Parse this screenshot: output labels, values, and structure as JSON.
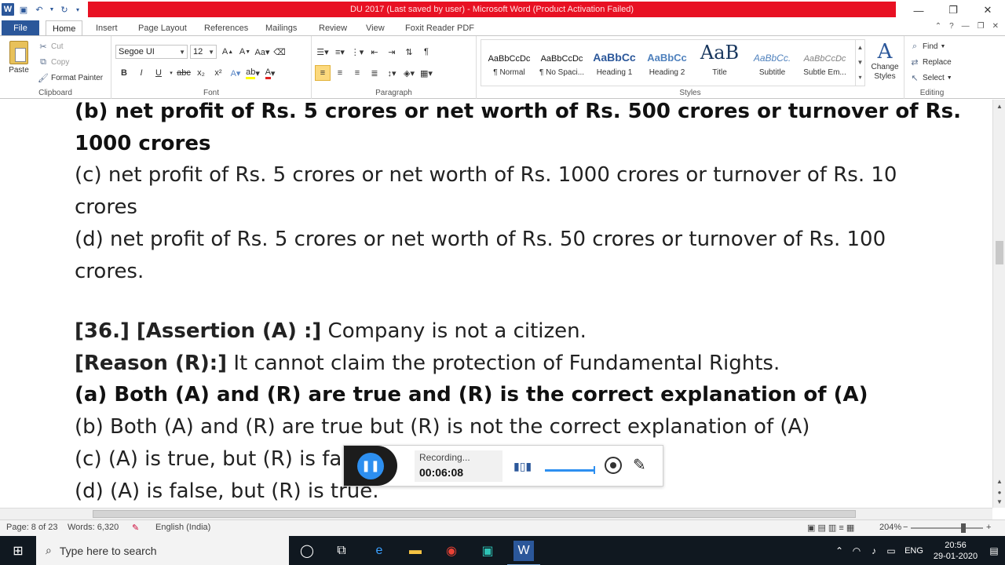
{
  "titlebar": {
    "title": "DU 2017 (Last saved by user)  -  Microsoft Word (Product Activation Failed)",
    "minimize": "—",
    "restore": "❐",
    "close": "✕"
  },
  "tabs": {
    "file": "File",
    "home": "Home",
    "insert": "Insert",
    "page_layout": "Page Layout",
    "references": "References",
    "mailings": "Mailings",
    "review": "Review",
    "view": "View",
    "foxit": "Foxit Reader PDF"
  },
  "ribbon": {
    "clipboard": {
      "paste": "Paste",
      "cut": "Cut",
      "copy": "Copy",
      "format_painter": "Format Painter",
      "label": "Clipboard"
    },
    "font": {
      "name": "Segoe UI",
      "size": "12",
      "label": "Font"
    },
    "paragraph": {
      "label": "Paragraph"
    },
    "styles": {
      "items": [
        {
          "preview": "AaBbCcDc",
          "name": "¶ Normal"
        },
        {
          "preview": "AaBbCcDc",
          "name": "¶ No Spaci..."
        },
        {
          "preview": "AaBbCc",
          "name": "Heading 1"
        },
        {
          "preview": "AaBbCc",
          "name": "Heading 2"
        },
        {
          "preview": "AaB",
          "name": "Title"
        },
        {
          "preview": "AaBbCc.",
          "name": "Subtitle"
        },
        {
          "preview": "AaBbCcDc",
          "name": "Subtle Em..."
        }
      ],
      "change_styles": "Change Styles",
      "label": "Styles"
    },
    "editing": {
      "find": "Find",
      "replace": "Replace",
      "select": "Select",
      "label": "Editing"
    }
  },
  "document": {
    "line_b1": "(b) net profit of Rs. 5 crores or net worth of Rs. 500 crores or turnover of Rs.",
    "line_b2": "1000 crores",
    "line_c1": "(c) net profit of Rs. 5 crores or net worth of Rs. 1000 crores or turnover of Rs. 10",
    "line_c2": "crores",
    "line_d1": "(d) net profit of Rs. 5 crores or net worth of Rs. 50 crores or turnover of Rs. 100",
    "line_d2": "crores.",
    "q36_label": "[36.] [Assertion (A) :]",
    "q36_text": " Company is not a citizen.",
    "reason_label": "[Reason (R):]",
    "reason_text": " It cannot claim the protection of Fundamental Rights.",
    "opt_a": "(a) Both (A) and (R) are true and (R) is the correct explanation of (A)",
    "opt_b": "(b) Both (A) and (R) are true but (R) is not the correct explanation of (A)",
    "opt_c": "(c) (A) is true, but (R) is fa",
    "opt_d": "(d) (A) is false, but (R) is true."
  },
  "recorder": {
    "status": "Recording...",
    "time": "00:06:08"
  },
  "statusbar": {
    "page": "Page: 8 of 23",
    "words": "Words: 6,320",
    "language": "English (India)",
    "zoom": "204%"
  },
  "taskbar": {
    "search_placeholder": "Type here to search",
    "lang": "ENG",
    "time": "20:56",
    "date": "29-01-2020"
  }
}
